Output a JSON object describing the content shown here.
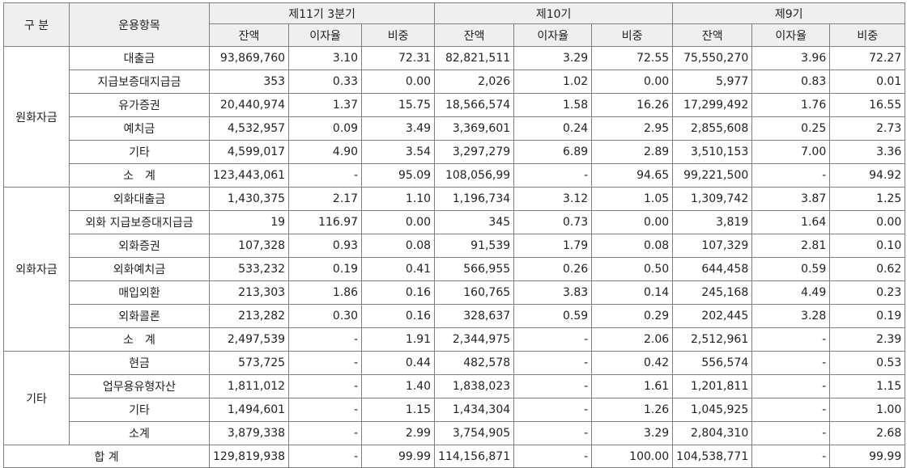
{
  "header": {
    "category": "구 분",
    "item": "운용항목",
    "periods": [
      "제11기 3분기",
      "제10기",
      "제9기"
    ],
    "subcols": [
      "잔액",
      "이자율",
      "비중"
    ]
  },
  "groups": [
    {
      "name": "원화자금",
      "rows": [
        {
          "item": "대출금",
          "vals": [
            "93,869,760",
            "3.10",
            "72.31",
            "82,821,511",
            "3.29",
            "72.55",
            "75,550,270",
            "3.96",
            "72.27"
          ]
        },
        {
          "item": "지급보증대지급금",
          "vals": [
            "353",
            "0.33",
            "0.00",
            "2,026",
            "1.02",
            "0.00",
            "5,977",
            "0.83",
            "0.01"
          ]
        },
        {
          "item": "유가증권",
          "vals": [
            "20,440,974",
            "1.37",
            "15.75",
            "18,566,574",
            "1.58",
            "16.26",
            "17,299,492",
            "1.76",
            "16.55"
          ]
        },
        {
          "item": "예치금",
          "vals": [
            "4,532,957",
            "0.09",
            "3.49",
            "3,369,601",
            "0.24",
            "2.95",
            "2,855,608",
            "0.25",
            "2.73"
          ]
        },
        {
          "item": "기타",
          "vals": [
            "4,599,017",
            "4.90",
            "3.54",
            "3,297,279",
            "6.89",
            "2.89",
            "3,510,153",
            "7.00",
            "3.36"
          ]
        },
        {
          "item": "소　계",
          "vals": [
            "123,443,061",
            "-",
            "95.09",
            "108,056,99",
            "-",
            "94.65",
            "99,221,500",
            "-",
            "94.92"
          ]
        }
      ]
    },
    {
      "name": "외화자금",
      "rows": [
        {
          "item": "외화대출금",
          "vals": [
            "1,430,375",
            "2.17",
            "1.10",
            "1,196,734",
            "3.12",
            "1.05",
            "1,309,742",
            "3.87",
            "1.25"
          ]
        },
        {
          "item": "외화 지급보증대지급금",
          "vals": [
            "19",
            "116.97",
            "0.00",
            "345",
            "0.73",
            "0.00",
            "3,819",
            "1.64",
            "0.00"
          ]
        },
        {
          "item": "외화증권",
          "vals": [
            "107,328",
            "0.93",
            "0.08",
            "91,539",
            "1.79",
            "0.08",
            "107,329",
            "2.81",
            "0.10"
          ]
        },
        {
          "item": "외화예치금",
          "vals": [
            "533,232",
            "0.19",
            "0.41",
            "566,955",
            "0.26",
            "0.50",
            "644,458",
            "0.59",
            "0.62"
          ]
        },
        {
          "item": "매입외환",
          "vals": [
            "213,303",
            "1.86",
            "0.16",
            "160,765",
            "3.83",
            "0.14",
            "245,168",
            "4.49",
            "0.23"
          ]
        },
        {
          "item": "외화콜론",
          "vals": [
            "213,282",
            "0.30",
            "0.16",
            "328,637",
            "0.59",
            "0.29",
            "202,445",
            "3.28",
            "0.19"
          ]
        },
        {
          "item": "소　계",
          "vals": [
            "2,497,539",
            "-",
            "1.91",
            "2,344,975",
            "-",
            "2.06",
            "2,512,961",
            "-",
            "2.39"
          ]
        }
      ]
    },
    {
      "name": "기타",
      "rows": [
        {
          "item": "현금",
          "vals": [
            "573,725",
            "-",
            "0.44",
            "482,578",
            "-",
            "0.42",
            "556,574",
            "-",
            "0.53"
          ]
        },
        {
          "item": "업무용유형자산",
          "vals": [
            "1,811,012",
            "-",
            "1.40",
            "1,838,023",
            "-",
            "1.61",
            "1,201,811",
            "-",
            "1.15"
          ]
        },
        {
          "item": "기타",
          "vals": [
            "1,494,601",
            "-",
            "1.15",
            "1,434,304",
            "-",
            "1.26",
            "1,045,925",
            "-",
            "1.00"
          ]
        },
        {
          "item": "소계",
          "vals": [
            "3,879,338",
            "-",
            "2.99",
            "3,754,905",
            "-",
            "3.29",
            "2,804,310",
            "-",
            "2.68"
          ]
        }
      ]
    }
  ],
  "total": {
    "label": "합 계",
    "vals": [
      "129,819,938",
      "-",
      "99.99",
      "114,156,871",
      "-",
      "100.00",
      "104,538,771",
      "-",
      "99.99"
    ]
  }
}
